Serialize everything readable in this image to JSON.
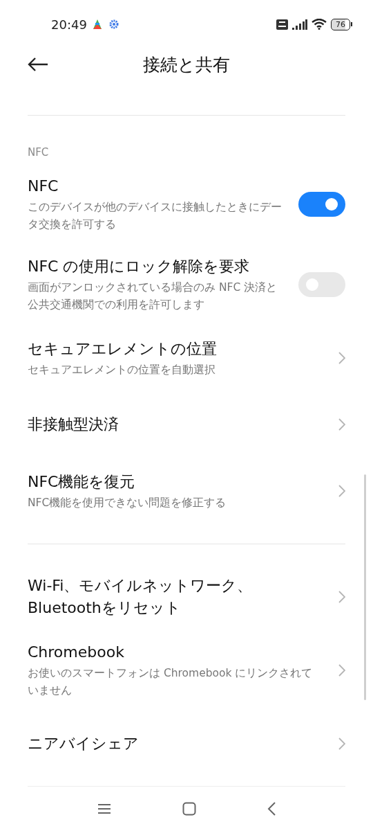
{
  "status_bar": {
    "time": "20:49",
    "battery": "76"
  },
  "header": {
    "title": "接続と共有"
  },
  "sections": [
    {
      "header": "NFC",
      "items": [
        {
          "kind": "toggle",
          "title": "NFC",
          "subtitle": "このデバイスが他のデバイスに接触したときにデータ交換を許可する",
          "on": true
        },
        {
          "kind": "toggle",
          "title": "NFC の使用にロック解除を要求",
          "subtitle": "画面がアンロックされている場合のみ NFC 決済と公共交通機関での利用を許可します",
          "on": false
        },
        {
          "kind": "link",
          "title": "セキュアエレメントの位置",
          "subtitle": "セキュアエレメントの位置を自動選択"
        },
        {
          "kind": "link",
          "title": "非接触型決済"
        },
        {
          "kind": "link",
          "title": "NFC機能を復元",
          "subtitle": "NFC機能を使用できない問題を修正する"
        }
      ]
    },
    {
      "items": [
        {
          "kind": "link",
          "title": "Wi-Fi、モバイルネットワーク、Bluetoothをリセット"
        },
        {
          "kind": "link",
          "title": "Chromebook",
          "subtitle": "お使いのスマートフォンは Chromebook にリンクされていません"
        },
        {
          "kind": "link",
          "title": "ニアバイシェア"
        }
      ]
    }
  ]
}
